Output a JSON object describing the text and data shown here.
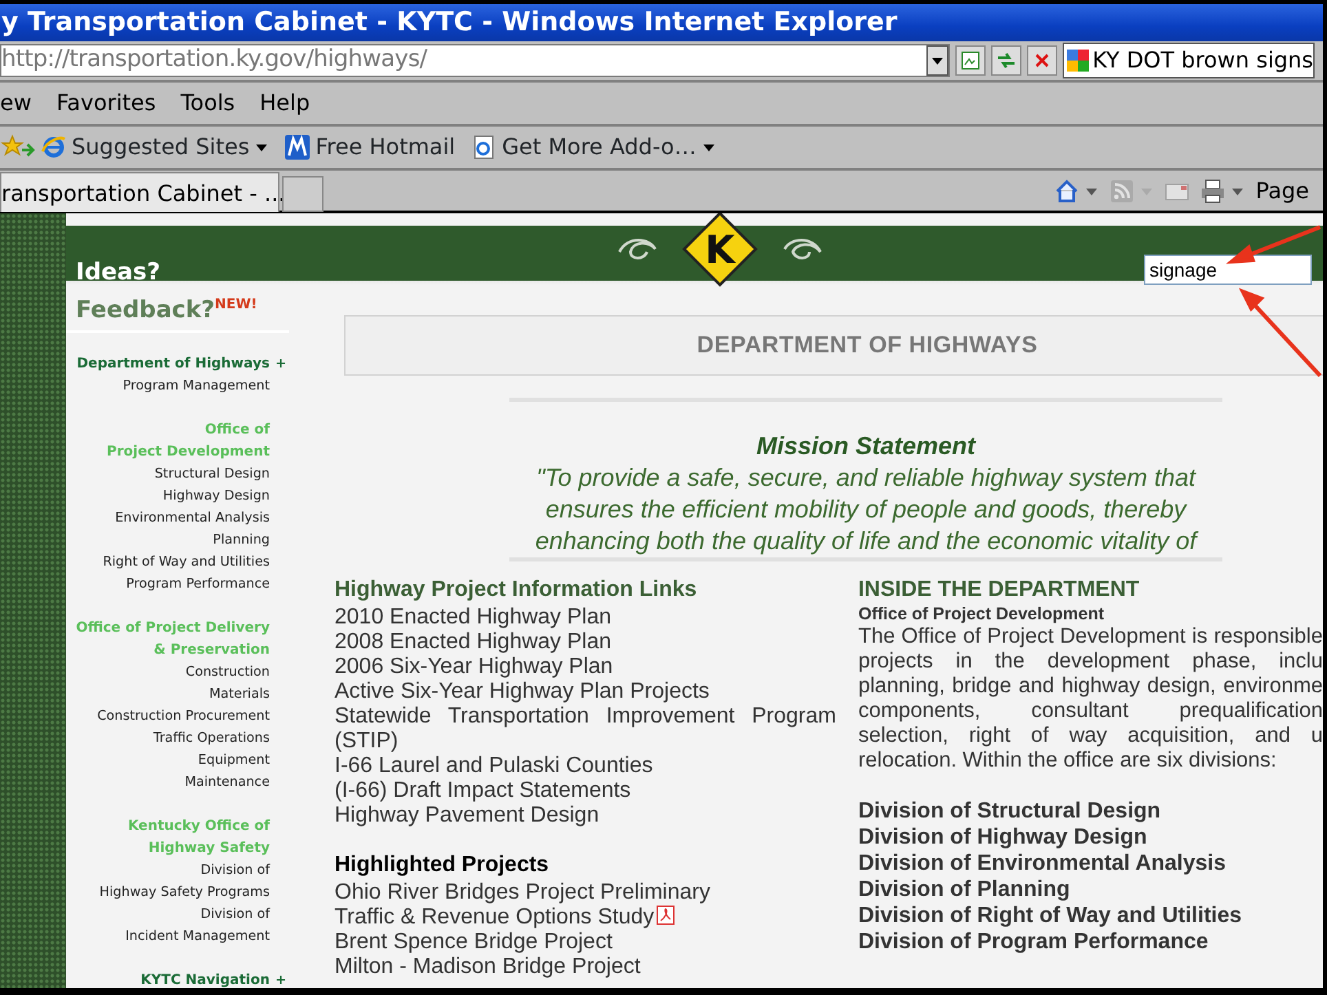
{
  "window": {
    "title": "y Transportation Cabinet - KYTC - Windows Internet Explorer"
  },
  "address_bar": {
    "url": "http://transportation.ky.gov/highways/",
    "search_value": "KY DOT brown signs"
  },
  "menu": [
    "ew",
    "Favorites",
    "Tools",
    "Help"
  ],
  "favorites_bar": [
    {
      "label": "Suggested Sites",
      "kind": "ie",
      "dropdown": true
    },
    {
      "label": "Free Hotmail",
      "kind": "hotmail",
      "dropdown": false
    },
    {
      "label": "Get More Add-o…",
      "kind": "page",
      "dropdown": true
    }
  ],
  "tabs": [
    {
      "label": "ransportation Cabinet - ...",
      "selected": true
    }
  ],
  "command_bar": [
    {
      "kind": "home",
      "dropdown": true,
      "disabled": false
    },
    {
      "kind": "feeds",
      "dropdown": true,
      "disabled": true
    },
    {
      "kind": "mail",
      "dropdown": false,
      "disabled": true
    },
    {
      "kind": "print",
      "dropdown": true,
      "disabled": false
    },
    {
      "kind": "text",
      "label": "Page",
      "dropdown": false,
      "disabled": false
    }
  ],
  "site_header": {
    "ideas": "Ideas?",
    "feedback": "Feedback?",
    "new_badge": "NEW!",
    "logo_letter": "K",
    "search_value": "signage"
  },
  "sidebar": [
    {
      "title": "Department of Highways",
      "kind": "department",
      "expander": "+",
      "items": [
        "Program Management"
      ]
    },
    {
      "title": "Office of\nProject Development",
      "kind": "office",
      "items": [
        "Structural Design",
        "Highway Design",
        "Environmental Analysis",
        "Planning",
        "Right of Way and Utilities",
        "Program Performance"
      ]
    },
    {
      "title": "Office of Project Delivery\n& Preservation",
      "kind": "office",
      "items": [
        "Construction",
        "Materials",
        "Construction Procurement",
        "Traffic Operations",
        "Equipment",
        "Maintenance"
      ]
    },
    {
      "title": "Kentucky Office of\nHighway Safety",
      "kind": "office",
      "items": [
        "Division of\nHighway Safety Programs",
        "Division of\nIncident Management"
      ]
    },
    {
      "title": "KYTC Navigation",
      "kind": "department",
      "expander": "+"
    }
  ],
  "main": {
    "heading": "DEPARTMENT OF HIGHWAYS",
    "mission": {
      "title": "Mission Statement",
      "lines": [
        "\"To provide a safe, secure, and reliable highway system that",
        "ensures the efficient mobility of people and goods, thereby",
        "enhancing both the quality of life and the economic vitality of"
      ]
    },
    "link_groups": [
      {
        "title": "Highway Project Information Links",
        "kind": "green",
        "links": [
          {
            "label": "2010 Enacted Highway Plan",
            "pdf": false
          },
          {
            "label": "2008 Enacted Highway Plan",
            "pdf": false
          },
          {
            "label": "2006 Six-Year Highway Plan",
            "pdf": false
          },
          {
            "label": "Active Six-Year Highway Plan Projects",
            "pdf": false
          },
          {
            "label": "Statewide Transportation Improvement Program (STIP)",
            "pdf": false
          },
          {
            "label": "I-66 Laurel and Pulaski Counties",
            "pdf": false
          },
          {
            "label": "(I-66) Draft Impact Statements",
            "pdf": false
          },
          {
            "label": "Highway Pavement Design",
            "pdf": false
          }
        ]
      },
      {
        "title": "Highlighted Projects",
        "kind": "black",
        "links": [
          {
            "label": "Ohio River Bridges Project Preliminary",
            "pdf": false
          },
          {
            "label": "Traffic & Revenue Options Study",
            "pdf": true
          },
          {
            "label": "Brent Spence Bridge Project",
            "pdf": false
          },
          {
            "label": "Milton - Madison Bridge Project",
            "pdf": false
          }
        ]
      }
    ],
    "inside": {
      "title": "INSIDE THE DEPARTMENT",
      "subtitle": "Office of Project Development",
      "paragraph_lines": [
        "The Office of Project Development is responsible",
        "projects in the development phase, inclu",
        "planning, bridge and highway design, environme",
        "components, consultant prequalification",
        "selection, right of way acquisition, and u",
        "relocation. Within the office are six divisions:"
      ],
      "divisions": [
        "Division of Structural Design",
        "Division of Highway Design",
        "Division of Environmental Analysis",
        "Division of Planning",
        "Division of Right of Way and Utilities",
        "Division of Program Performance"
      ]
    }
  }
}
